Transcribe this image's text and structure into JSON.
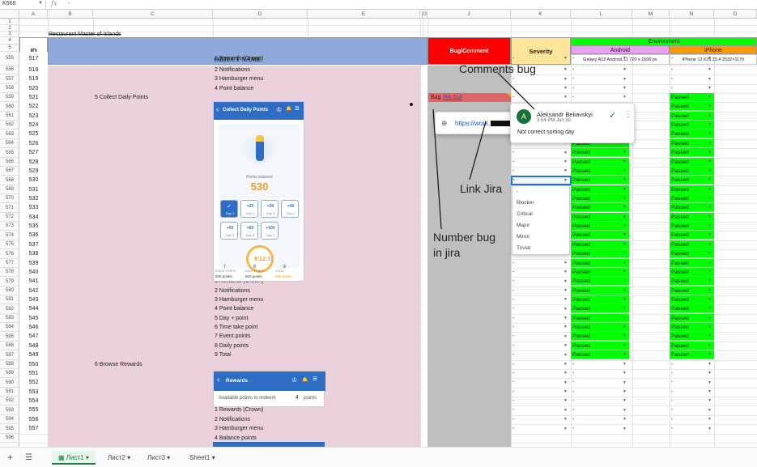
{
  "formula_bar": {
    "cell_ref": "K568",
    "fx": "fx",
    "value": "-"
  },
  "columns": [
    "A",
    "B",
    "C",
    "D",
    "E",
    "G",
    "J",
    "K",
    "L",
    "M",
    "N",
    "O"
  ],
  "header": {
    "title": "Restaurant Master of Islands",
    "id_label": "ID",
    "object_name_label": "OBJECT NAME",
    "bug_label": "Bug/Comment",
    "severity_label": "Severity",
    "environment_label": "Environment",
    "android_label": "Android",
    "iphone_label": "iPhone",
    "android_device": "Galaxy A12 Android 11 720 x 1600 px",
    "iphone_device": "iPhone 12 iOS 15.4 2532×1170"
  },
  "row_numbers": [
    "1",
    "2",
    "3",
    "4",
    "5",
    "555",
    "556",
    "557",
    "558",
    "559",
    "560",
    "561",
    "562",
    "563",
    "564",
    "565",
    "566",
    "567",
    "568",
    "569",
    "570",
    "571",
    "572",
    "573",
    "574",
    "575",
    "576",
    "577",
    "578",
    "579",
    "580",
    "581",
    "582",
    "583",
    "584",
    "585",
    "586",
    "587",
    "588",
    "589",
    "590",
    "591",
    "592",
    "593",
    "594",
    "595",
    "596"
  ],
  "ids": [
    "517",
    "518",
    "519",
    "520",
    "521",
    "522",
    "523",
    "524",
    "525",
    "526",
    "527",
    "528",
    "529",
    "530",
    "531",
    "532",
    "533",
    "534",
    "535",
    "536",
    "537",
    "538",
    "539",
    "540",
    "541",
    "542",
    "543",
    "544",
    "545",
    "546",
    "547",
    "548",
    "549",
    "550",
    "551",
    "552",
    "553",
    "554",
    "555",
    "556",
    "557"
  ],
  "items_top": [
    "1 Rewards (Crown)",
    "2 Notifications",
    "3 Hamburger menu",
    "4 Point balance"
  ],
  "section_daily": "5 Collect Daily Points",
  "items_mid": [
    "1 Rewards (Crown)",
    "2 Notifications",
    "3 Hamburger menu",
    "4 Point balance",
    "5 Day + point",
    "6 Time take point",
    "7 Event points",
    "8 Daily points",
    "9 Total"
  ],
  "section_browse": "6 Browse Rewards",
  "items_bottom": [
    "1 Rewards (Crown)",
    "2 Notifications",
    "3 Hamburger menu",
    "4 Balance points"
  ],
  "bug": {
    "prefix": "Bug",
    "link": "RA-114"
  },
  "link_popup": {
    "url": "https://work."
  },
  "comment": {
    "initial": "A",
    "author": "Aleksandr Beliavskyi",
    "time": "3:54 PM Jun 30",
    "text": "Not correct sorting day"
  },
  "severity_options": [
    "-",
    "Blocker",
    "Critical",
    "Major",
    "Minor",
    "Trivial"
  ],
  "status": "Passed",
  "dash": "-",
  "annotations": {
    "comments": "Comments bug",
    "link": "Link Jira",
    "number_line1": "Number bug",
    "number_line2": "in jira"
  },
  "phone1": {
    "title": "Collect Daily Points",
    "balance_label": "Points balance",
    "balance": "530",
    "counter": "8:12:3",
    "days": [
      {
        "pts": "",
        "day": "Day 1"
      },
      {
        "pts": "+20",
        "day": "Day 2"
      },
      {
        "pts": "+30",
        "day": "Day 3"
      },
      {
        "pts": "+40",
        "day": "Day 4"
      },
      {
        "pts": "+50",
        "day": "Day 5"
      },
      {
        "pts": "+60",
        "day": "Day 6"
      },
      {
        "pts": "+100",
        "day": "Day 7"
      }
    ],
    "footer": [
      {
        "n": "7",
        "l": "EVENT POINTS",
        "v": "500 points"
      },
      {
        "n": "8",
        "l": "DAILY POINTS",
        "v": "520 points"
      },
      {
        "n": "9",
        "l": "TOTAL",
        "v": "530 points"
      }
    ]
  },
  "phone2": {
    "title": "Rewards",
    "available": "Available points to redeem",
    "points": "4",
    "points_label": "points"
  },
  "sheet_tabs": [
    "Лист1",
    "Лист2",
    "Лист3",
    "Sheet1"
  ],
  "colors": {
    "bug_header": "#ff0000",
    "severity_header": "#ffe599",
    "env_header": "#00ff00",
    "android_header": "#ea9ef5",
    "iphone_header": "#ff9900",
    "name_header": "#8eaadb",
    "name_fill": "#ead1dc",
    "bug_fill": "#bfbfbf",
    "passed": "#00ff00",
    "phone_blue": "#2f6dc4"
  }
}
